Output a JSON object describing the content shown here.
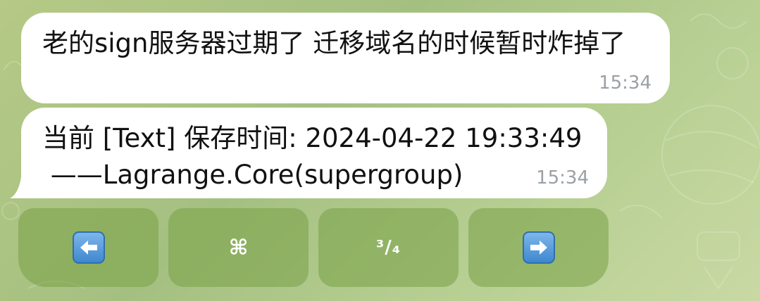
{
  "messages": [
    {
      "text": "老的sign服务器过期了 迁移域名的时候暂时炸掉了",
      "time": "15:34"
    },
    {
      "text": "当前 [Text] 保存时间: 2024-04-22 19:33:49\n ——Lagrange.Core(supergroup)",
      "time": "15:34"
    }
  ],
  "keyboard": {
    "buttons": [
      {
        "icon": "left-arrow-emoji-icon"
      },
      {
        "label": "⌘"
      },
      {
        "label": "³/₄"
      },
      {
        "icon": "right-arrow-emoji-icon"
      }
    ]
  },
  "colors": {
    "background": "#a9c383",
    "bubble": "#ffffff",
    "time": "#9aa0a6",
    "button": "#8aae55",
    "emoji_blue": "#4a90d9"
  }
}
